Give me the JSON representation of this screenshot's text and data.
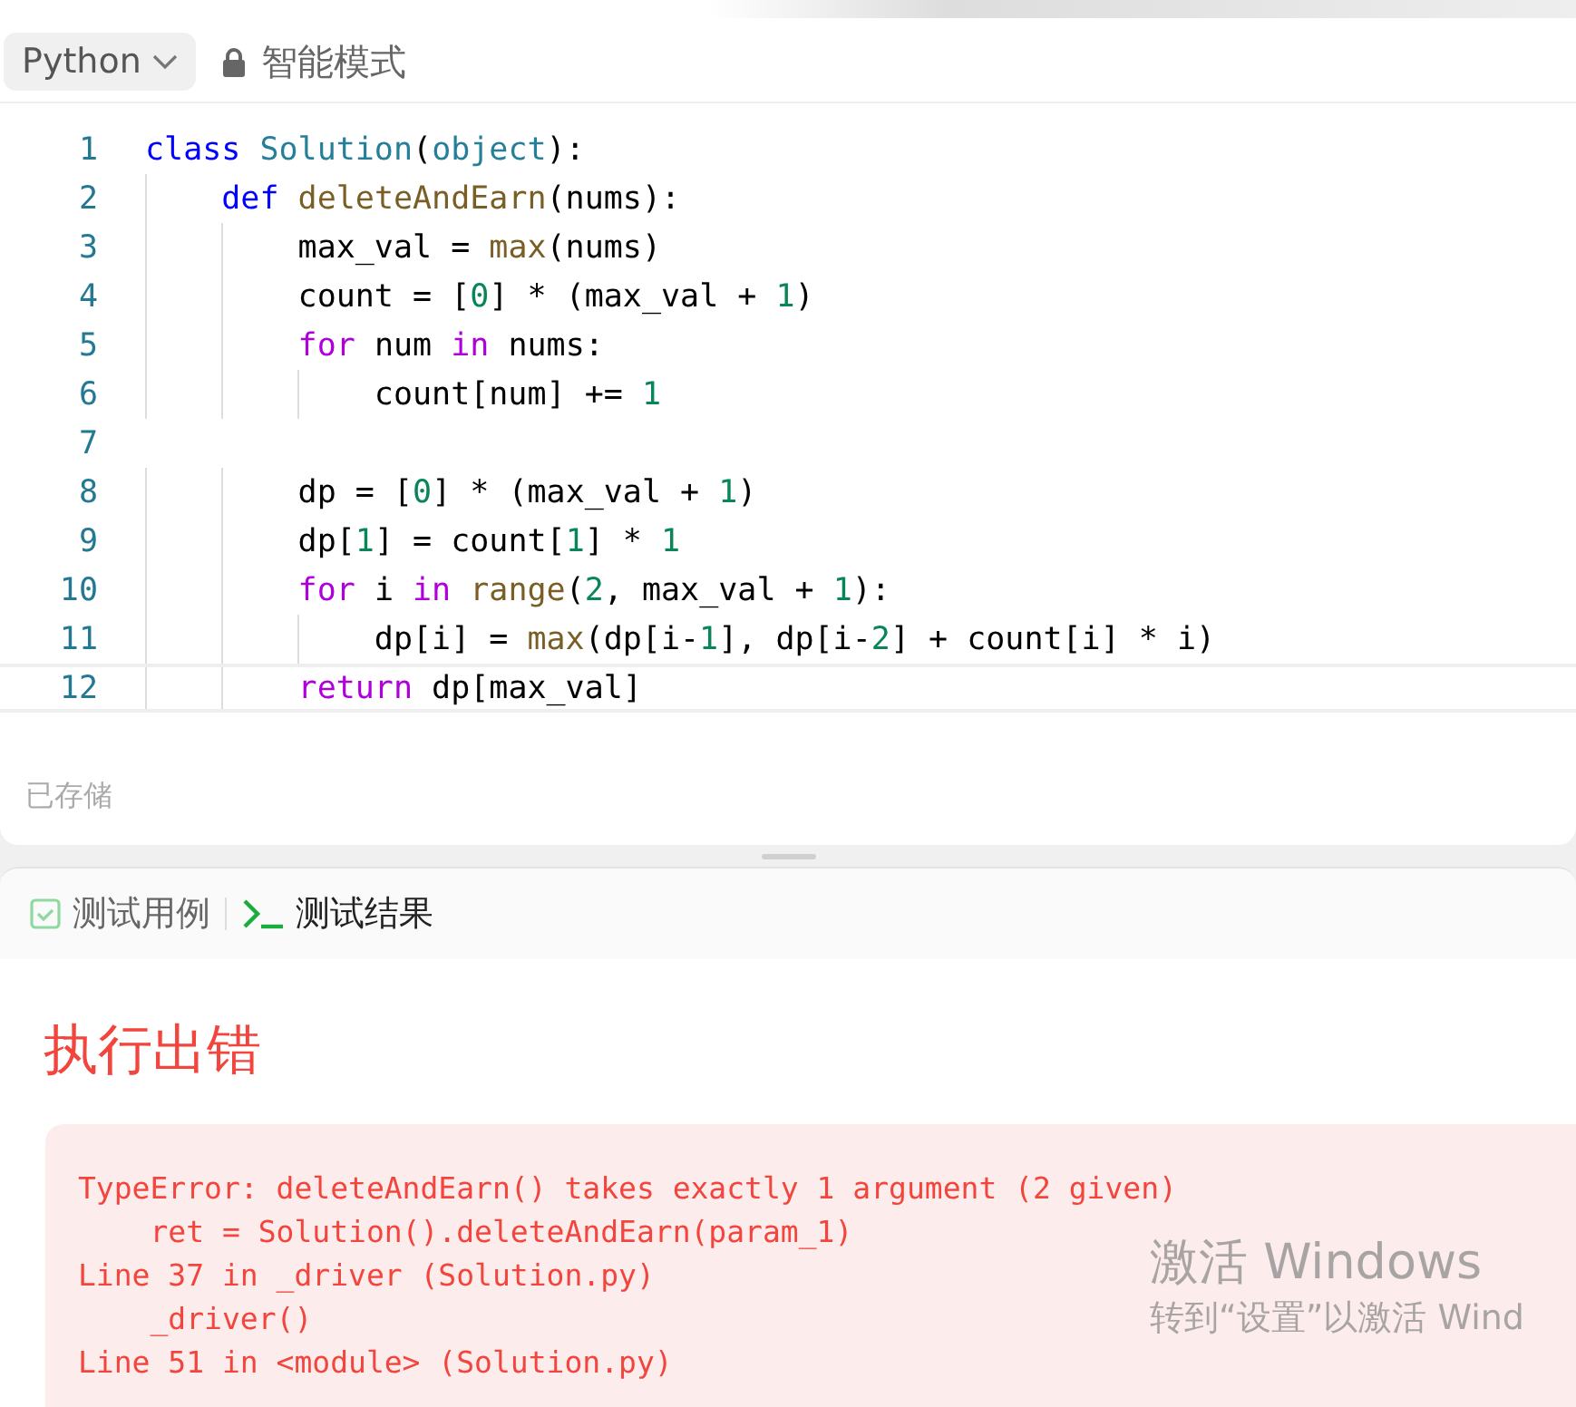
{
  "toolbar": {
    "language": "Python",
    "mode": "智能模式"
  },
  "editor": {
    "lines": [
      {
        "number": "1",
        "current": false,
        "tokens": [
          {
            "kind": "keyword",
            "text": "class "
          },
          {
            "kind": "type",
            "text": "Solution"
          },
          {
            "kind": "plain",
            "text": "("
          },
          {
            "kind": "type",
            "text": "object"
          },
          {
            "kind": "plain",
            "text": "):"
          }
        ]
      },
      {
        "number": "2",
        "current": false,
        "tokens": [
          {
            "kind": "keyword",
            "text": "    def "
          },
          {
            "kind": "function",
            "text": "deleteAndEarn"
          },
          {
            "kind": "plain",
            "text": "(nums):"
          }
        ]
      },
      {
        "number": "3",
        "current": false,
        "tokens": [
          {
            "kind": "plain",
            "text": "        max_val = "
          },
          {
            "kind": "function",
            "text": "max"
          },
          {
            "kind": "plain",
            "text": "(nums)"
          }
        ]
      },
      {
        "number": "4",
        "current": false,
        "tokens": [
          {
            "kind": "plain",
            "text": "        count = ["
          },
          {
            "kind": "number",
            "text": "0"
          },
          {
            "kind": "plain",
            "text": "] * (max_val + "
          },
          {
            "kind": "number",
            "text": "1"
          },
          {
            "kind": "plain",
            "text": ")"
          }
        ]
      },
      {
        "number": "5",
        "current": false,
        "tokens": [
          {
            "kind": "control",
            "text": "        for"
          },
          {
            "kind": "plain",
            "text": " num "
          },
          {
            "kind": "control",
            "text": "in"
          },
          {
            "kind": "plain",
            "text": " nums:"
          }
        ]
      },
      {
        "number": "6",
        "current": false,
        "tokens": [
          {
            "kind": "plain",
            "text": "            count[num] += "
          },
          {
            "kind": "number",
            "text": "1"
          }
        ]
      },
      {
        "number": "7",
        "current": false
      },
      {
        "number": "8",
        "current": false,
        "tokens": [
          {
            "kind": "plain",
            "text": "        dp = ["
          },
          {
            "kind": "number",
            "text": "0"
          },
          {
            "kind": "plain",
            "text": "] * (max_val + "
          },
          {
            "kind": "number",
            "text": "1"
          },
          {
            "kind": "plain",
            "text": ")"
          }
        ]
      },
      {
        "number": "9",
        "current": false,
        "tokens": [
          {
            "kind": "plain",
            "text": "        dp["
          },
          {
            "kind": "number",
            "text": "1"
          },
          {
            "kind": "plain",
            "text": "] = count["
          },
          {
            "kind": "number",
            "text": "1"
          },
          {
            "kind": "plain",
            "text": "] * "
          },
          {
            "kind": "number",
            "text": "1"
          }
        ]
      },
      {
        "number": "10",
        "current": false,
        "tokens": [
          {
            "kind": "control",
            "text": "        for"
          },
          {
            "kind": "plain",
            "text": " i "
          },
          {
            "kind": "control",
            "text": "in "
          },
          {
            "kind": "function",
            "text": "range"
          },
          {
            "kind": "plain",
            "text": "("
          },
          {
            "kind": "number",
            "text": "2"
          },
          {
            "kind": "plain",
            "text": ", max_val + "
          },
          {
            "kind": "number",
            "text": "1"
          },
          {
            "kind": "plain",
            "text": "):"
          }
        ]
      },
      {
        "number": "11",
        "current": false,
        "tokens": [
          {
            "kind": "plain",
            "text": "            dp[i] = "
          },
          {
            "kind": "function",
            "text": "max"
          },
          {
            "kind": "plain",
            "text": "(dp[i-"
          },
          {
            "kind": "number",
            "text": "1"
          },
          {
            "kind": "plain",
            "text": "], dp[i-"
          },
          {
            "kind": "number",
            "text": "2"
          },
          {
            "kind": "plain",
            "text": "] + count[i] * i)"
          }
        ]
      },
      {
        "number": "12",
        "current": true,
        "tokens": [
          {
            "kind": "control",
            "text": "        return"
          },
          {
            "kind": "plain",
            "text": " dp[max_val]"
          }
        ]
      }
    ]
  },
  "save_status": "已存储",
  "tabs": [
    {
      "label": "测试用例",
      "kind": "case",
      "selected": false
    },
    {
      "label": "测试结果",
      "kind": "result",
      "selected": true
    }
  ],
  "result": {
    "title": "执行出错",
    "error_lines": [
      "TypeError: deleteAndEarn() takes exactly 1 argument (2 given)",
      "    ret = Solution().deleteAndEarn(param_1)",
      "Line 37 in _driver (Solution.py)",
      "    _driver()",
      "Line 51 in <module> (Solution.py)"
    ]
  },
  "os_overlay": {
    "title": "激活 Windows",
    "subtitle": "转到“设置”以激活 Wind"
  }
}
